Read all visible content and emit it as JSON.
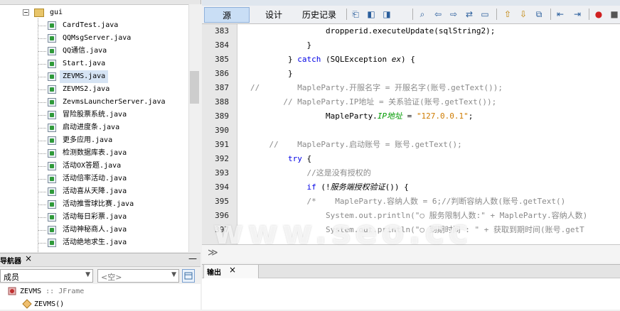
{
  "project_tree": {
    "package": "gui",
    "files": [
      "CardTest.java",
      "QQMsgServer.java",
      "QQ通信.java",
      "Start.java",
      "ZEVMS.java",
      "ZEVMS2.java",
      "ZevmsLauncherServer.java",
      "冒险股票系统.java",
      "启动进度条.java",
      "更多应用.java",
      "检测数据库表.java",
      "活动OX答题.java",
      "活动倍率活动.java",
      "活动喜从天降.java",
      "活动推雪球比赛.java",
      "活动每日彩票.java",
      "活动神秘商人.java",
      "活动绝地求生.java"
    ],
    "selected_index": 4
  },
  "navigator": {
    "title": "导航器",
    "close_glyph": "×",
    "minimize_glyph": "—",
    "combo_filter": "成员",
    "combo_empty": "<空>",
    "items": [
      {
        "label": "ZEVMS",
        "suffix": " :: JFrame"
      },
      {
        "label": "ZEVMS()"
      }
    ]
  },
  "editor": {
    "tabs": {
      "source": "源",
      "design": "设计",
      "history": "历史记录"
    },
    "lines": [
      {
        "n": "383",
        "html": "<span>                dropperid.executeUpdate(sqlString2);</span>"
      },
      {
        "n": "384",
        "html": "<span>            }</span>"
      },
      {
        "n": "385",
        "html": "<span>        } </span><span class='kw'>catch</span><span> (SQLException </span><span class='it'>ex</span><span>) {</span>"
      },
      {
        "n": "386",
        "html": "<span>        }</span>"
      },
      {
        "n": "387",
        "html": "<span class='cm'>//        MapleParty.开服名字 = 开服名字(账号.getText());</span>"
      },
      {
        "n": "388",
        "html": "<span class='cm'>       // MapleParty.IP地址 = 关系验证(账号.getText());</span>"
      },
      {
        "n": "389",
        "html": "<span>                MapleParty.</span><span class='fld'>IP地址</span><span> = </span><span class='st'>\"127.0.0.1\"</span><span>;</span>"
      },
      {
        "n": "390",
        "html": ""
      },
      {
        "n": "391",
        "html": "<span class='cm'>    //    MapleParty.启动账号 = 账号.getText();</span>"
      },
      {
        "n": "392",
        "html": "<span>        </span><span class='kw'>try</span><span> {</span>"
      },
      {
        "n": "393",
        "html": "<span class='cm'>            //这是没有授权的</span>"
      },
      {
        "n": "394",
        "html": "<span>            </span><span class='kw'>if</span><span> (!</span><span class='it'>服务端授权验证</span><span>()) {</span>"
      },
      {
        "n": "395",
        "html": "<span class='cm'>            /*    MapleParty.容纳人数 = 6;//判断容纳人数(账号.getText()</span>"
      },
      {
        "n": "396",
        "html": "<span class='cm'>                System.out.println(\"○ 服务限制人数:\" + MapleParty.容纳人数)</span>"
      },
      {
        "n": "397",
        "html": "<span class='cm'>                System.out.println(\"○ 到期时间 : \" + 获取到期时间(账号.getT</span>"
      }
    ]
  },
  "output": {
    "title": "输出",
    "close_glyph": "×"
  },
  "watermark": "www.seo.cc",
  "colors": {
    "keyword": "#0000e6",
    "comment": "#8a8a8a",
    "string": "#ce7b00",
    "field": "#009a00",
    "selection": "#d6e4f4"
  }
}
